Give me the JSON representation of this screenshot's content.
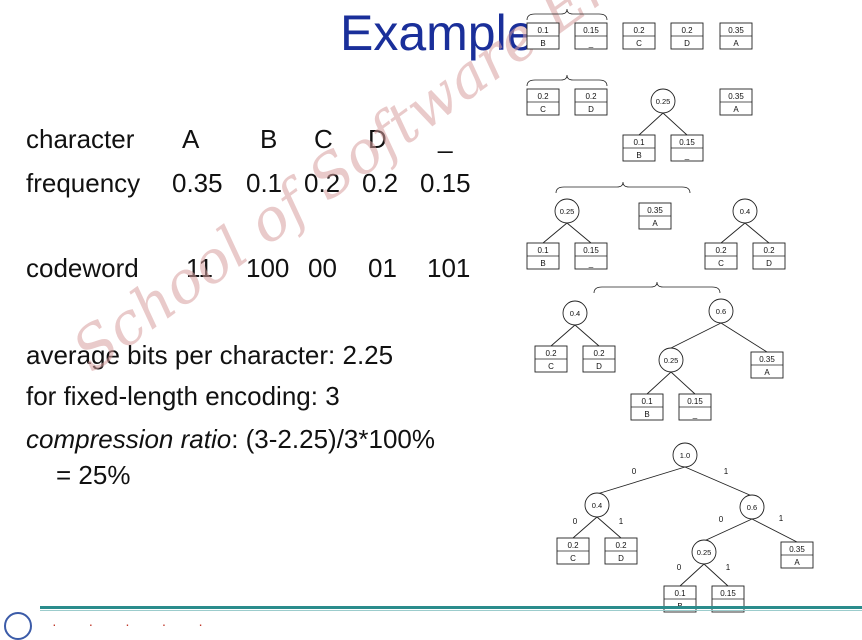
{
  "title": "Example",
  "table": {
    "char_label": "character",
    "chars": [
      "A",
      "B",
      "C",
      "D",
      "_"
    ],
    "freq_label": "frequency",
    "freqs": [
      "0.35",
      "0.1",
      "0.2",
      "0.2",
      "0.15"
    ],
    "code_label": "codeword",
    "codes": [
      "11",
      "100",
      "00",
      "01",
      "101"
    ]
  },
  "summary": {
    "avg_line": "average bits per character: 2.25",
    "fixed_line": "for fixed-length encoding:   3",
    "ratio_label": "compression ratio",
    "ratio_expr": ": (3-2.25)/3*100%",
    "ratio_result": "= 25%"
  },
  "watermark": "School of Software Engineering",
  "diagram": {
    "leaves": {
      "A": {
        "freq": "0.35",
        "char": "A"
      },
      "B": {
        "freq": "0.1",
        "char": "B"
      },
      "C": {
        "freq": "0.2",
        "char": "C"
      },
      "D": {
        "freq": "0.2",
        "char": "D"
      },
      "U": {
        "freq": "0.15",
        "char": "_"
      }
    },
    "internal": {
      "n025": "0.25",
      "n04": "0.4",
      "n06": "0.6",
      "n10": "1.0"
    },
    "edge_bits": [
      "0",
      "1"
    ]
  },
  "colors": {
    "title": "#1a2f9a",
    "footer_line": "#2a8c8c",
    "watermark": "#d8a0a0"
  }
}
